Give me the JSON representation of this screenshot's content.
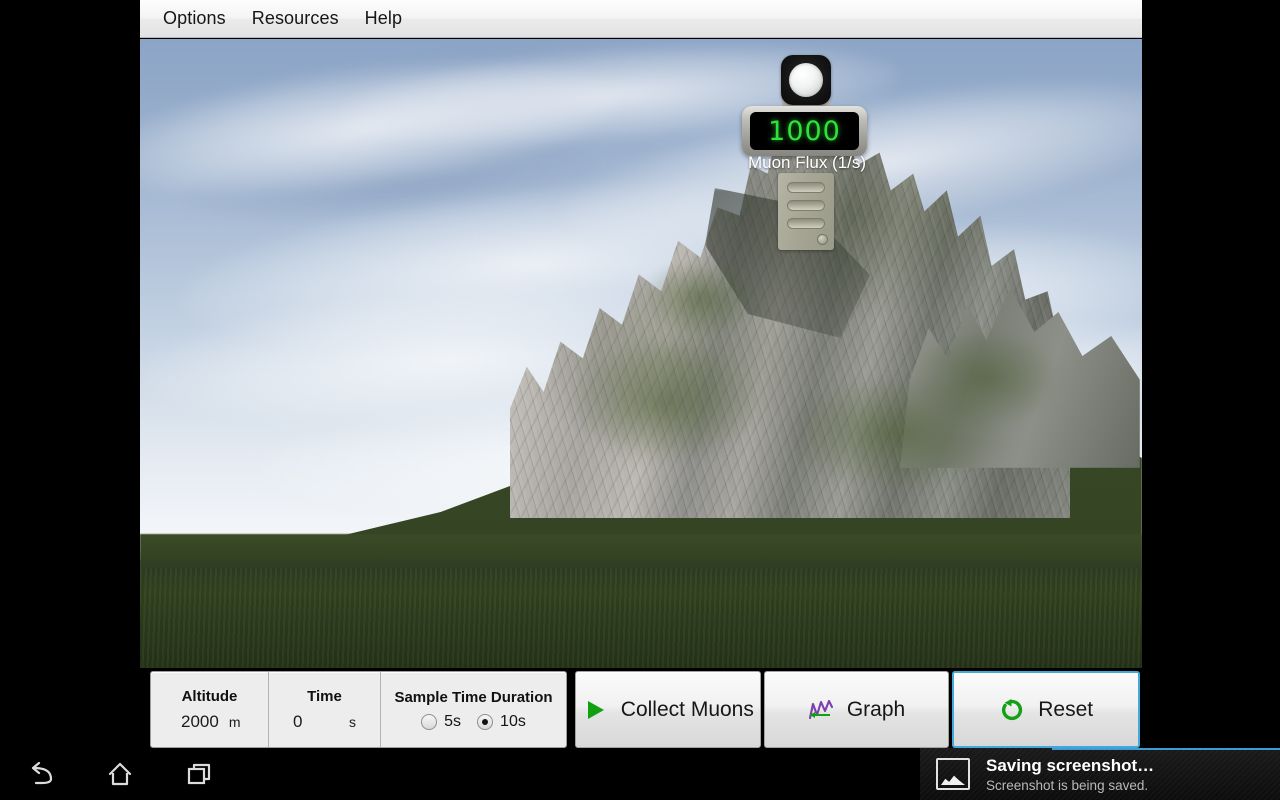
{
  "app": {
    "menu": {
      "items": [
        {
          "label": "Options",
          "name": "menu-options"
        },
        {
          "label": "Resources",
          "name": "menu-resources"
        },
        {
          "label": "Help",
          "name": "menu-help"
        }
      ]
    },
    "scene": {
      "description": "3D mountain landscape with muon detector on summit",
      "colors": {
        "sky_top": "#8ca4c6",
        "sky_horizon": "#ffffff",
        "water": "#d2dbe4",
        "grass": "#2e3d22",
        "rock": "#a9a6a2"
      }
    },
    "detector": {
      "flux_value": "1000",
      "flux_label": "Muon Flux  (1/s)",
      "lcd_text_color": "#2fe23a",
      "lcd_background": "#000000"
    },
    "readouts": [
      {
        "title": "Altitude",
        "value": "2000",
        "unit": "m"
      },
      {
        "title": "Time",
        "value": "0",
        "unit": "s"
      }
    ],
    "sample_time": {
      "title": "Sample Time Duration",
      "options": [
        {
          "label": "5s",
          "selected": false
        },
        {
          "label": "10s",
          "selected": true
        }
      ]
    },
    "buttons": [
      {
        "label": "Collect Muons",
        "icon": "play-icon",
        "icon_color": "#10a010",
        "focused": false
      },
      {
        "label": "Graph",
        "icon": "graph-icon",
        "icon_color": "#7b3fae",
        "focused": false
      },
      {
        "label": "Reset",
        "icon": "reset-icon",
        "icon_color": "#13a013",
        "focused": true
      }
    ]
  },
  "system": {
    "nav": [
      {
        "name": "back-icon",
        "label": "Back"
      },
      {
        "name": "home-icon",
        "label": "Home"
      },
      {
        "name": "recents-icon",
        "label": "Recent apps"
      }
    ],
    "notification": {
      "icon": "image-icon",
      "title": "Saving screenshot…",
      "subtitle": "Screenshot is being saved.",
      "accent": "#3d9bd6"
    }
  }
}
